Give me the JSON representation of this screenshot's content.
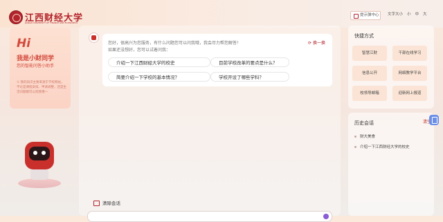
{
  "header": {
    "logo_name": "江西财经大学",
    "logo_sub": "JIANGXI UNIVERSITY OF FINANCE AND ECONOMICS",
    "help_button": "提示弹中心",
    "font_size_label": "文字大小",
    "font_sizes": [
      "小",
      "中",
      "大"
    ]
  },
  "left_panel": {
    "hi": "Hi",
    "intro_title": "我是小财同学",
    "intro_sub": "您的智能问答小助手",
    "info": "① 我的知识主要来源于学校网站，不论是课程安排、申请调整，还是生活问题都可以找我哦～"
  },
  "chat": {
    "greeting": "您好，很高兴为您服务，有什么问题您可以问我哦，我会尽力帮您解答！",
    "greeting2": "如果还没想好，您可以试着问我：",
    "refresh_label": "换一换",
    "questions": [
      "介绍一下江西财经大学的校史",
      "目前学校改革的要点是什么？",
      "简要介绍一下学校的基本情况？",
      "学校开设了哪些学科？"
    ],
    "clear_label": "清除会话"
  },
  "quick_panel": {
    "title": "快捷方式",
    "items": [
      "智慧江财",
      "干部在线学习",
      "信息公开",
      "网络教学平台",
      "校领导邮箱",
      "迎新网上报道"
    ]
  },
  "history": {
    "title": "历史会话",
    "more_label": "清空",
    "items": [
      "财大美食",
      "介绍一下江西财经大学的校史"
    ]
  }
}
